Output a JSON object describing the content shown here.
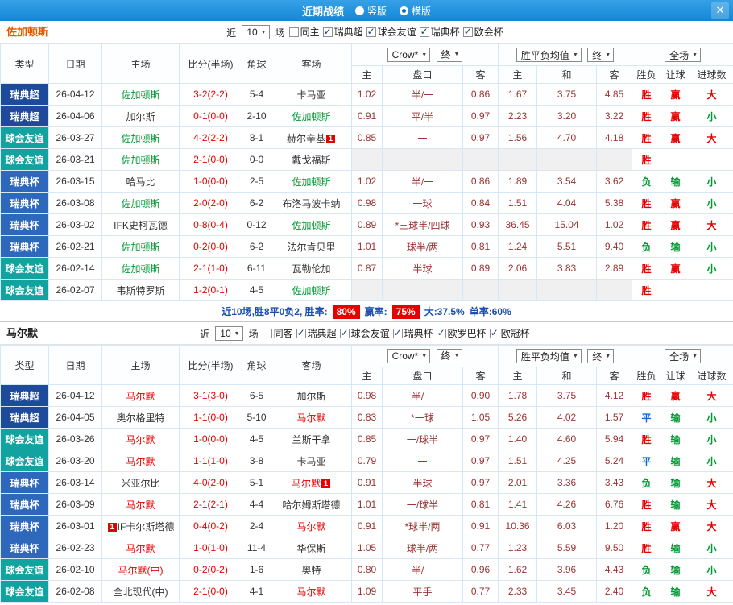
{
  "colors": {
    "topbar_blue": "#1287d6",
    "navy_league": "#1e4a9b",
    "teal_league": "#12a3a0",
    "blue_league": "#2e68bd",
    "red": "#e60000",
    "green": "#009933",
    "blue": "#0a6adb",
    "orange": "#e25a00",
    "odds_brown": "#993333"
  },
  "titlebar": {
    "title": "近期战绩",
    "options": [
      {
        "label": "竖版",
        "selected": false
      },
      {
        "label": "横版",
        "selected": true
      }
    ],
    "close_icon": "✕"
  },
  "table_header": {
    "type": "类型",
    "date": "日期",
    "home": "主场",
    "score": "比分(半场)",
    "corner": "角球",
    "away": "客场",
    "o_home": "主",
    "o_hcap": "盘口",
    "o_away": "客",
    "a_home": "主",
    "a_draw": "和",
    "a_away": "客",
    "result": "胜负",
    "handicap": "让球",
    "goals": "进球数",
    "sel_company": "Crow*",
    "sel_final1": "终",
    "sel_avg": "胜平负均值",
    "sel_final2": "终",
    "sel_scope": "全场"
  },
  "sections": [
    {
      "team": "佐加顿斯",
      "near": "近",
      "count": "10",
      "unit": "场",
      "filters": [
        {
          "label": "同主",
          "checked": false
        },
        {
          "label": "瑞典超",
          "checked": true
        },
        {
          "label": "球会友谊",
          "checked": true
        },
        {
          "label": "瑞典杯",
          "checked": true
        },
        {
          "label": "欧会杯",
          "checked": true
        }
      ],
      "rows": [
        {
          "lg": "瑞典超",
          "lc": "super",
          "date": "26-04-12",
          "home": {
            "n": "佐加顿斯",
            "c": "green"
          },
          "score": "3-2(2-2)",
          "corner": "5-4",
          "away": {
            "n": "卡马亚",
            "c": ""
          },
          "odds": [
            "1.02",
            "半/一",
            "0.86"
          ],
          "avg": [
            "1.67",
            "3.75",
            "4.85"
          ],
          "res": [
            "胜",
            "red"
          ],
          "let": [
            "赢",
            "red"
          ],
          "goal": [
            "大",
            "red"
          ]
        },
        {
          "lg": "瑞典超",
          "lc": "super",
          "date": "26-04-06",
          "home": {
            "n": "加尔斯",
            "c": ""
          },
          "score": "0-1(0-0)",
          "corner": "2-10",
          "away": {
            "n": "佐加顿斯",
            "c": "green"
          },
          "odds": [
            "0.91",
            "平/半",
            "0.97"
          ],
          "avg": [
            "2.23",
            "3.20",
            "3.22"
          ],
          "res": [
            "胜",
            "red"
          ],
          "let": [
            "赢",
            "red"
          ],
          "goal": [
            "小",
            "green"
          ]
        },
        {
          "lg": "球会友谊",
          "lc": "friendly",
          "date": "26-03-27",
          "home": {
            "n": "佐加顿斯",
            "c": "green"
          },
          "score": "4-2(2-2)",
          "corner": "8-1",
          "away": {
            "n": "赫尔辛基",
            "c": "",
            "badge": "1",
            "badgePos": "after"
          },
          "odds": [
            "0.85",
            "一",
            "0.97"
          ],
          "avg": [
            "1.56",
            "4.70",
            "4.18"
          ],
          "res": [
            "胜",
            "red"
          ],
          "let": [
            "赢",
            "red"
          ],
          "goal": [
            "大",
            "red"
          ]
        },
        {
          "lg": "球会友谊",
          "lc": "friendly",
          "date": "26-03-21",
          "home": {
            "n": "佐加顿斯",
            "c": "green"
          },
          "score": "2-1(0-0)",
          "corner": "0-0",
          "away": {
            "n": "戴戈福斯",
            "c": ""
          },
          "odds": null,
          "avg": null,
          "res": [
            "胜",
            "red"
          ],
          "let": null,
          "goal": null
        },
        {
          "lg": "瑞典杯",
          "lc": "cup",
          "date": "26-03-15",
          "home": {
            "n": "哈马比",
            "c": ""
          },
          "score": "1-0(0-0)",
          "corner": "2-5",
          "away": {
            "n": "佐加顿斯",
            "c": "green"
          },
          "odds": [
            "1.02",
            "半/一",
            "0.86"
          ],
          "avg": [
            "1.89",
            "3.54",
            "3.62"
          ],
          "res": [
            "负",
            "green"
          ],
          "let": [
            "输",
            "green"
          ],
          "goal": [
            "小",
            "green"
          ]
        },
        {
          "lg": "瑞典杯",
          "lc": "cup",
          "date": "26-03-08",
          "home": {
            "n": "佐加顿斯",
            "c": "green"
          },
          "score": "2-0(2-0)",
          "corner": "6-2",
          "away": {
            "n": "布洛马波卡纳",
            "c": ""
          },
          "odds": [
            "0.98",
            "一球",
            "0.84"
          ],
          "avg": [
            "1.51",
            "4.04",
            "5.38"
          ],
          "res": [
            "胜",
            "red"
          ],
          "let": [
            "赢",
            "red"
          ],
          "goal": [
            "小",
            "green"
          ]
        },
        {
          "lg": "瑞典杯",
          "lc": "cup",
          "date": "26-03-02",
          "home": {
            "n": "IFK史柯瓦德",
            "c": ""
          },
          "score": "0-8(0-4)",
          "corner": "0-12",
          "away": {
            "n": "佐加顿斯",
            "c": "green"
          },
          "odds": [
            "0.89",
            "*三球半/四球",
            "0.93"
          ],
          "avg": [
            "36.45",
            "15.04",
            "1.02"
          ],
          "res": [
            "胜",
            "red"
          ],
          "let": [
            "赢",
            "red"
          ],
          "goal": [
            "大",
            "red"
          ]
        },
        {
          "lg": "瑞典杯",
          "lc": "cup",
          "date": "26-02-21",
          "home": {
            "n": "佐加顿斯",
            "c": "green"
          },
          "score": "0-2(0-0)",
          "corner": "6-2",
          "away": {
            "n": "法尔肯贝里",
            "c": ""
          },
          "odds": [
            "1.01",
            "球半/两",
            "0.81"
          ],
          "avg": [
            "1.24",
            "5.51",
            "9.40"
          ],
          "res": [
            "负",
            "green"
          ],
          "let": [
            "输",
            "green"
          ],
          "goal": [
            "小",
            "green"
          ]
        },
        {
          "lg": "球会友谊",
          "lc": "friendly",
          "date": "26-02-14",
          "home": {
            "n": "佐加顿斯",
            "c": "green"
          },
          "score": "2-1(1-0)",
          "corner": "6-11",
          "away": {
            "n": "瓦勒伦加",
            "c": ""
          },
          "odds": [
            "0.87",
            "半球",
            "0.89"
          ],
          "avg": [
            "2.06",
            "3.83",
            "2.89"
          ],
          "res": [
            "胜",
            "red"
          ],
          "let": [
            "赢",
            "red"
          ],
          "goal": [
            "小",
            "green"
          ]
        },
        {
          "lg": "球会友谊",
          "lc": "friendly",
          "date": "26-02-07",
          "home": {
            "n": "韦斯特罗斯",
            "c": ""
          },
          "score": "1-2(0-1)",
          "corner": "4-5",
          "away": {
            "n": "佐加顿斯",
            "c": "green"
          },
          "odds": null,
          "avg": null,
          "res": [
            "胜",
            "red"
          ],
          "let": null,
          "goal": null
        }
      ],
      "summary": [
        {
          "t": "近10场,胜8平0负2, 胜率:",
          "c": "navy"
        },
        {
          "t": "80%",
          "c": "badge"
        },
        {
          "t": "赢率:",
          "c": "navy"
        },
        {
          "t": "75%",
          "c": "badge"
        },
        {
          "t": "大:37.5%",
          "c": "navy"
        },
        {
          "t": "单率:60%",
          "c": "navy"
        }
      ]
    },
    {
      "team": "马尔默",
      "near": "近",
      "count": "10",
      "unit": "场",
      "filters": [
        {
          "label": "同客",
          "checked": false
        },
        {
          "label": "瑞典超",
          "checked": true
        },
        {
          "label": "球会友谊",
          "checked": true
        },
        {
          "label": "瑞典杯",
          "checked": true
        },
        {
          "label": "欧罗巴杯",
          "checked": true
        },
        {
          "label": "欧冠杯",
          "checked": true
        }
      ],
      "rows": [
        {
          "lg": "瑞典超",
          "lc": "super",
          "date": "26-04-12",
          "home": {
            "n": "马尔默",
            "c": "red"
          },
          "score": "3-1(3-0)",
          "corner": "6-5",
          "away": {
            "n": "加尔斯",
            "c": ""
          },
          "odds": [
            "0.98",
            "半/一",
            "0.90"
          ],
          "avg": [
            "1.78",
            "3.75",
            "4.12"
          ],
          "res": [
            "胜",
            "red"
          ],
          "let": [
            "赢",
            "red"
          ],
          "goal": [
            "大",
            "red"
          ]
        },
        {
          "lg": "瑞典超",
          "lc": "super",
          "date": "26-04-05",
          "home": {
            "n": "奥尔格里特",
            "c": ""
          },
          "score": "1-1(0-0)",
          "corner": "5-10",
          "away": {
            "n": "马尔默",
            "c": "red"
          },
          "odds": [
            "0.83",
            "*一球",
            "1.05"
          ],
          "avg": [
            "5.26",
            "4.02",
            "1.57"
          ],
          "res": [
            "平",
            "blue"
          ],
          "let": [
            "输",
            "green"
          ],
          "goal": [
            "小",
            "green"
          ]
        },
        {
          "lg": "球会友谊",
          "lc": "friendly",
          "date": "26-03-26",
          "home": {
            "n": "马尔默",
            "c": "red"
          },
          "score": "1-0(0-0)",
          "corner": "4-5",
          "away": {
            "n": "兰斯干拿",
            "c": ""
          },
          "odds": [
            "0.85",
            "一/球半",
            "0.97"
          ],
          "avg": [
            "1.40",
            "4.60",
            "5.94"
          ],
          "res": [
            "胜",
            "red"
          ],
          "let": [
            "输",
            "green"
          ],
          "goal": [
            "小",
            "green"
          ]
        },
        {
          "lg": "球会友谊",
          "lc": "friendly",
          "date": "26-03-20",
          "home": {
            "n": "马尔默",
            "c": "red"
          },
          "score": "1-1(1-0)",
          "corner": "3-8",
          "away": {
            "n": "卡马亚",
            "c": ""
          },
          "odds": [
            "0.79",
            "一",
            "0.97"
          ],
          "avg": [
            "1.51",
            "4.25",
            "5.24"
          ],
          "res": [
            "平",
            "blue"
          ],
          "let": [
            "输",
            "green"
          ],
          "goal": [
            "小",
            "green"
          ]
        },
        {
          "lg": "瑞典杯",
          "lc": "cup",
          "date": "26-03-14",
          "home": {
            "n": "米亚尔比",
            "c": ""
          },
          "score": "4-0(2-0)",
          "corner": "5-1",
          "away": {
            "n": "马尔默",
            "c": "red",
            "badge": "1",
            "badgePos": "after"
          },
          "odds": [
            "0.91",
            "半球",
            "0.97"
          ],
          "avg": [
            "2.01",
            "3.36",
            "3.43"
          ],
          "res": [
            "负",
            "green"
          ],
          "let": [
            "输",
            "green"
          ],
          "goal": [
            "大",
            "red"
          ]
        },
        {
          "lg": "瑞典杯",
          "lc": "cup",
          "date": "26-03-09",
          "home": {
            "n": "马尔默",
            "c": "red"
          },
          "score": "2-1(2-1)",
          "corner": "4-4",
          "away": {
            "n": "哈尔姆斯塔德",
            "c": ""
          },
          "odds": [
            "1.01",
            "一/球半",
            "0.81"
          ],
          "avg": [
            "1.41",
            "4.26",
            "6.76"
          ],
          "res": [
            "胜",
            "red"
          ],
          "let": [
            "输",
            "green"
          ],
          "goal": [
            "大",
            "red"
          ]
        },
        {
          "lg": "瑞典杯",
          "lc": "cup",
          "date": "26-03-01",
          "home": {
            "n": "IF卡尔斯塔德",
            "c": "",
            "badge": "1",
            "badgePos": "before"
          },
          "score": "0-4(0-2)",
          "corner": "2-4",
          "away": {
            "n": "马尔默",
            "c": "red"
          },
          "odds": [
            "0.91",
            "*球半/两",
            "0.91"
          ],
          "avg": [
            "10.36",
            "6.03",
            "1.20"
          ],
          "res": [
            "胜",
            "red"
          ],
          "let": [
            "赢",
            "red"
          ],
          "goal": [
            "大",
            "red"
          ]
        },
        {
          "lg": "瑞典杯",
          "lc": "cup",
          "date": "26-02-23",
          "home": {
            "n": "马尔默",
            "c": "red"
          },
          "score": "1-0(1-0)",
          "corner": "11-4",
          "away": {
            "n": "华保斯",
            "c": ""
          },
          "odds": [
            "1.05",
            "球半/两",
            "0.77"
          ],
          "avg": [
            "1.23",
            "5.59",
            "9.50"
          ],
          "res": [
            "胜",
            "red"
          ],
          "let": [
            "输",
            "green"
          ],
          "goal": [
            "小",
            "green"
          ]
        },
        {
          "lg": "球会友谊",
          "lc": "friendly",
          "date": "26-02-10",
          "home": {
            "n": "马尔默(中)",
            "c": "red"
          },
          "score": "0-2(0-2)",
          "corner": "1-6",
          "away": {
            "n": "奥特",
            "c": ""
          },
          "odds": [
            "0.80",
            "半/一",
            "0.96"
          ],
          "avg": [
            "1.62",
            "3.96",
            "4.43"
          ],
          "res": [
            "负",
            "green"
          ],
          "let": [
            "输",
            "green"
          ],
          "goal": [
            "小",
            "green"
          ]
        },
        {
          "lg": "球会友谊",
          "lc": "friendly",
          "date": "26-02-08",
          "home": {
            "n": "全北现代(中)",
            "c": ""
          },
          "score": "2-1(0-0)",
          "corner": "4-1",
          "away": {
            "n": "马尔默",
            "c": "red"
          },
          "odds": [
            "1.09",
            "平手",
            "0.77"
          ],
          "avg": [
            "2.33",
            "3.45",
            "2.40"
          ],
          "res": [
            "负",
            "green"
          ],
          "let": [
            "输",
            "green"
          ],
          "goal": [
            "大",
            "red"
          ]
        }
      ],
      "summary": null
    }
  ]
}
